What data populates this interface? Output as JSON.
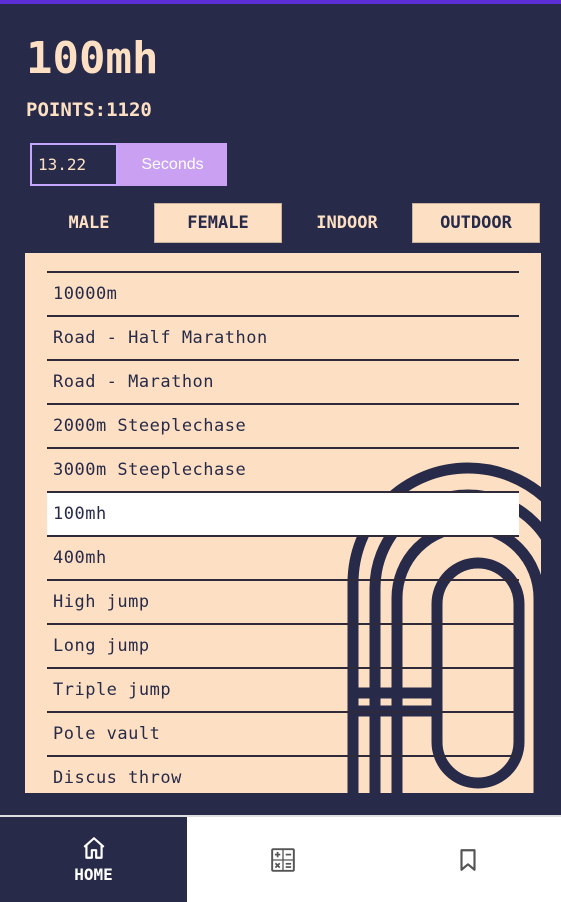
{
  "header": {
    "event_title": "100mh",
    "points_text": "POINTS:1120"
  },
  "input": {
    "time_value": "13.22",
    "unit_label": "Seconds"
  },
  "toggles": {
    "male": "MALE",
    "female": "FEMALE",
    "indoor": "INDOOR",
    "outdoor": "OUTDOOR",
    "selected_gender": "FEMALE",
    "selected_venue": "OUTDOOR"
  },
  "events": [
    "10000m",
    "Road - Half Marathon",
    "Road - Marathon",
    "2000m Steeplechase",
    "3000m Steeplechase",
    "100mh",
    "400mh",
    "High jump",
    "Long jump",
    "Triple jump",
    "Pole vault",
    "Discus throw"
  ],
  "selected_event": "100mh",
  "nav": {
    "home_label": "HOME",
    "home_icon": "home-icon",
    "calculator_icon": "calculator-icon",
    "bookmark_icon": "bookmark-icon"
  },
  "colors": {
    "background": "#272a48",
    "cream": "#fde0c4",
    "accent": "#c9a0f2",
    "top_bar": "#5b2ed6"
  }
}
